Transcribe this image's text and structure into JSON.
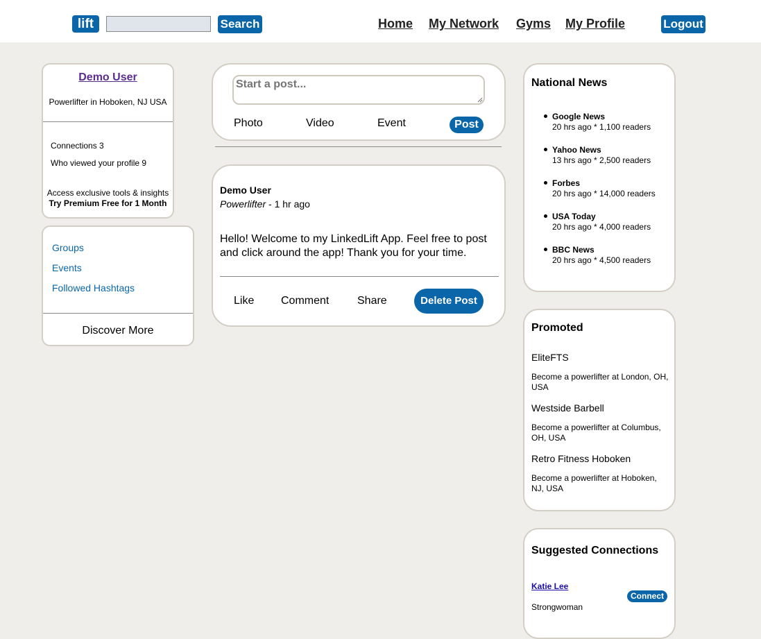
{
  "header": {
    "logo": "lift",
    "search_value": "",
    "search_button": "Search",
    "nav": [
      "Home",
      "My Network",
      "Gyms",
      "My Profile"
    ],
    "logout_button": "Logout"
  },
  "profile": {
    "name": "Demo User",
    "location": "Powerlifter in Hoboken, NJ USA",
    "connections_label": "Connections 3",
    "viewers_label": "Who viewed your profile 9",
    "premium_line1": "Access exclusive tools & insights",
    "premium_line2": "Try Premium Free for 1 Month"
  },
  "side_links": {
    "items": [
      "Groups",
      "Events",
      "Followed Hashtags"
    ],
    "discover": "Discover More"
  },
  "composer": {
    "placeholder": "Start a post...",
    "actions": [
      "Photo",
      "Video",
      "Event"
    ],
    "post_button": "Post"
  },
  "post": {
    "author": "Demo User",
    "role": "Powerlifter",
    "time": " - 1 hr ago",
    "body": "Hello! Welcome to my LinkedLift App. Feel free to post and click around the app! Thank you for your time.",
    "actions": [
      "Like",
      "Comment",
      "Share"
    ],
    "delete_button": "Delete Post"
  },
  "news": {
    "title": "National News",
    "items": [
      {
        "name": "Google News",
        "meta": "20 hrs ago * 1,100 readers"
      },
      {
        "name": "Yahoo News",
        "meta": "13 hrs ago * 2,500 readers"
      },
      {
        "name": "Forbes",
        "meta": "20 hrs ago * 14,000 readers"
      },
      {
        "name": "USA Today",
        "meta": "20 hrs ago * 4,000 readers"
      },
      {
        "name": "BBC News",
        "meta": "20 hrs ago * 4,500 readers"
      }
    ]
  },
  "promoted": {
    "title": "Promoted",
    "items": [
      {
        "name": "EliteFTS",
        "desc": "Become a powerlifter at London, OH, USA"
      },
      {
        "name": "Westside Barbell",
        "desc": "Become a powerlifter at Columbus, OH, USA"
      },
      {
        "name": "Retro Fitness Hoboken",
        "desc": "Become a powerlifter at Hoboken, NJ, USA"
      }
    ]
  },
  "suggestions": {
    "title": "Suggested Connections",
    "items": [
      {
        "name": "Katie Lee",
        "role": "Strongwoman",
        "button": "Connect"
      }
    ]
  },
  "colors": {
    "accent": "#0a66a8",
    "background": "#efeeea",
    "card_border": "#d3cfc5",
    "profile_link": "#5c2d91"
  }
}
